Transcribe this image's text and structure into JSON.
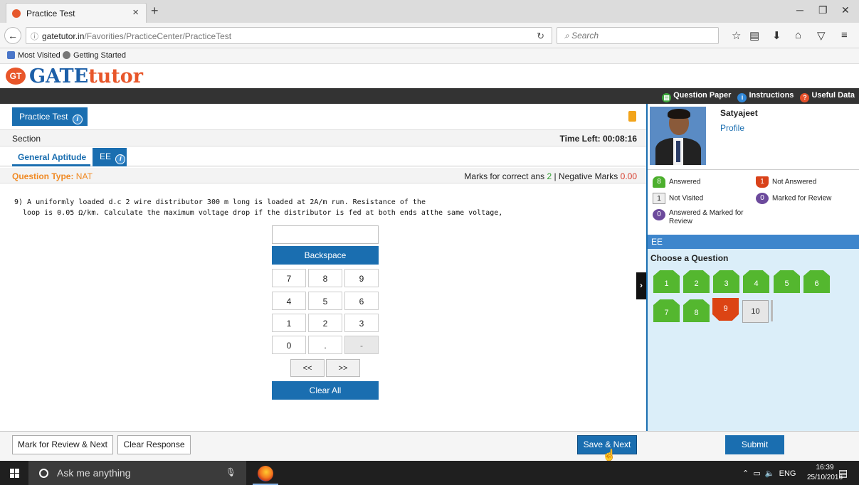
{
  "browser": {
    "tab_title": "Practice Test",
    "url_domain": "gatetutor.in",
    "url_path": "/Favorities/PracticeCenter/PracticeTest",
    "search_placeholder": "Search",
    "bookmarks": [
      "Most Visited",
      "Getting Started"
    ]
  },
  "site": {
    "logo_prefix": "GT",
    "logo_bold": "GATE",
    "logo_light": "tutor",
    "top_links": {
      "question_paper": "Question Paper",
      "instructions": "Instructions",
      "useful_data": "Useful Data"
    }
  },
  "test": {
    "title": "Practice Test",
    "section_label": "Section",
    "time_left": "Time Left: 00:08:16",
    "tabs": [
      "General Aptitude",
      "EE"
    ],
    "question_type_label": "Question Type:",
    "question_type": "NAT",
    "marks_prefix": "Marks for correct ans",
    "correct_marks": "2",
    "marks_sep": "| Negative Marks",
    "negative_marks": "0.00",
    "question_line1": "9) A uniformly loaded d.c 2 wire distributor 300 m long is loaded at 2A/m run. Resistance of the",
    "question_line2": "loop is 0.05 Ω/km. Calculate the maximum voltage drop if the distributor is fed at both ends atthe same voltage,"
  },
  "keypad": {
    "backspace": "Backspace",
    "keys": [
      "7",
      "8",
      "9",
      "4",
      "5",
      "6",
      "1",
      "2",
      "3",
      "0",
      ".",
      "-"
    ],
    "left": "<<",
    "right": ">>",
    "clear_all": "Clear All"
  },
  "candidate": {
    "name": "Satyajeet",
    "profile_link": "Profile"
  },
  "legend": {
    "answered_count": "8",
    "answered": "Answered",
    "not_answered_count": "1",
    "not_answered": "Not Answered",
    "not_visited_count": "1",
    "not_visited": "Not Visited",
    "marked_count": "0",
    "marked": "Marked for Review",
    "ans_marked_count": "0",
    "ans_marked": "Answered & Marked for Review"
  },
  "palette": {
    "section": "EE",
    "choose": "Choose a Question",
    "questions": [
      {
        "n": "1",
        "status": "answered"
      },
      {
        "n": "2",
        "status": "answered"
      },
      {
        "n": "3",
        "status": "answered"
      },
      {
        "n": "4",
        "status": "answered"
      },
      {
        "n": "5",
        "status": "answered"
      },
      {
        "n": "6",
        "status": "answered"
      },
      {
        "n": "7",
        "status": "answered"
      },
      {
        "n": "8",
        "status": "answered"
      },
      {
        "n": "9",
        "status": "not-answered"
      },
      {
        "n": "10",
        "status": "not-visited"
      }
    ]
  },
  "footer": {
    "mark_review": "Mark for Review & Next",
    "clear_response": "Clear Response",
    "save_next": "Save & Next",
    "submit": "Submit"
  },
  "taskbar": {
    "search": "Ask me anything",
    "lang": "ENG",
    "time": "16:39",
    "date": "25/10/2016"
  },
  "colors": {
    "primary": "#1a6eb0",
    "answered": "#54b72f",
    "not_answered": "#dc4414",
    "marked": "#6c4a9c",
    "accent": "#f08a24"
  }
}
